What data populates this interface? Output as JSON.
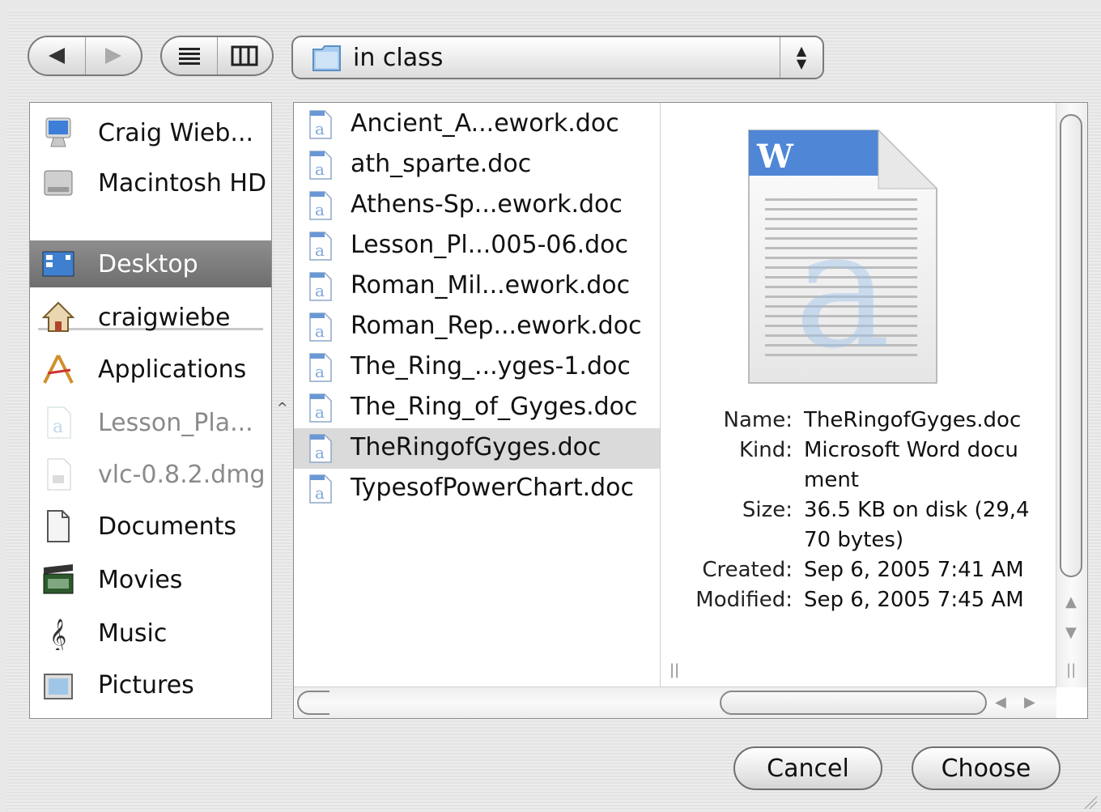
{
  "toolbar": {
    "back_icon": "back-arrow-icon",
    "forward_icon": "forward-arrow-icon",
    "list_view_icon": "list-view-icon",
    "column_view_icon": "column-view-icon",
    "location": "in class"
  },
  "sidebar": {
    "items": [
      {
        "label": "Craig Wieb...",
        "icon": "computer-icon"
      },
      {
        "label": "Macintosh HD",
        "icon": "hard-drive-icon"
      },
      {
        "label": "Desktop",
        "icon": "desktop-icon"
      },
      {
        "label": "craigwiebe",
        "icon": "home-icon"
      },
      {
        "label": "Applications",
        "icon": "applications-icon"
      },
      {
        "label": "Lesson_Pla...",
        "icon": "word-doc-icon"
      },
      {
        "label": "vlc-0.8.2.dmg",
        "icon": "dmg-file-icon"
      },
      {
        "label": "Documents",
        "icon": "documents-icon"
      },
      {
        "label": "Movies",
        "icon": "movies-icon"
      },
      {
        "label": "Music",
        "icon": "music-icon"
      },
      {
        "label": "Pictures",
        "icon": "pictures-icon"
      }
    ]
  },
  "files": [
    "Ancient_A...ework.doc",
    "ath_sparte.doc",
    "Athens-Sp...ework.doc",
    "Lesson_Pl...005-06.doc",
    "Roman_Mil...ework.doc",
    "Roman_Rep...ework.doc",
    "The_Ring_...yges-1.doc",
    "The_Ring_of_Gyges.doc",
    "TheRingofGyges.doc",
    "TypesofPowerChart.doc"
  ],
  "selected_file": "TheRingofGyges.doc",
  "preview": {
    "name_label": "Name:",
    "name_value": "TheRingofGyges.doc",
    "kind_label": "Kind:",
    "kind_value": "Microsoft Word document",
    "size_label": "Size:",
    "size_value": "36.5 KB on disk (29,470 bytes)",
    "created_label": "Created:",
    "created_value": "Sep 6, 2005 7:41 AM",
    "modified_label": "Modified:",
    "modified_value": "Sep 6, 2005 7:45 AM"
  },
  "buttons": {
    "cancel": "Cancel",
    "choose": "Choose"
  }
}
